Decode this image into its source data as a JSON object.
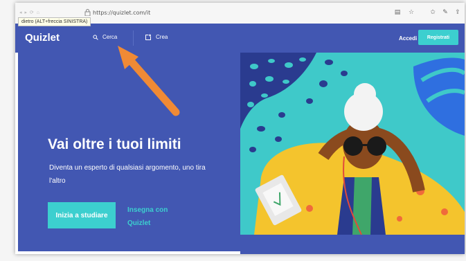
{
  "browser": {
    "url": "https://quizlet.com/it",
    "tooltip": "dietro (ALT+freccia SINISTRA)"
  },
  "header": {
    "logo": "Quizlet",
    "search_label": "Cerca",
    "create_label": "Crea",
    "login_label": "Accedi",
    "signup_label": "Registrati"
  },
  "hero": {
    "title": "Vai oltre i tuoi limiti",
    "subtitle": "Diventa un esperto di qualsiasi argomento, uno tira l'altro",
    "cta_label": "Inizia a studiare",
    "teach_label": "Insegna con Quizlet"
  },
  "colors": {
    "brand": "#4257b2",
    "accent": "#3ccfcf",
    "arrow": "#f08a35"
  },
  "icons": {
    "search": "search-icon",
    "create": "create-icon",
    "lock": "lock-icon",
    "annotation_arrow": "arrow-annotation-icon"
  }
}
